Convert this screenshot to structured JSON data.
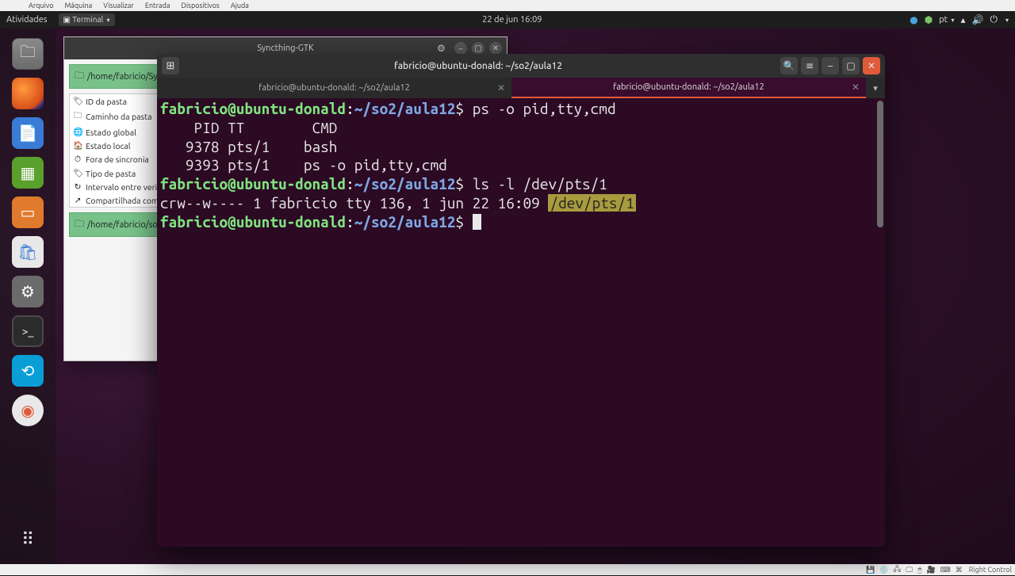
{
  "vbox_menu": {
    "items": [
      "Arquivo",
      "Máquina",
      "Visualizar",
      "Entrada",
      "Dispositivos",
      "Ajuda"
    ]
  },
  "top_panel": {
    "activities": "Atividades",
    "app": "Terminal",
    "clock": "22 de jun  16:09",
    "lang": "pt"
  },
  "syncthing": {
    "title": "Syncthing-GTK",
    "entry1": "/home/fabricio/Sy",
    "rows": [
      {
        "icon": "🏷",
        "label": "ID da pasta"
      },
      {
        "icon": "🗀",
        "label": "Caminho da pasta"
      },
      {
        "icon": "🌐",
        "label": "Estado global"
      },
      {
        "icon": "🏠",
        "label": "Estado local"
      },
      {
        "icon": "⏱",
        "label": "Fora de sincronia"
      },
      {
        "icon": "🏷",
        "label": "Tipo de pasta"
      },
      {
        "icon": "↻",
        "label": "Intervalo entre verifica"
      },
      {
        "icon": "↗",
        "label": "Compartilhada com"
      }
    ],
    "entry2": "/home/fabricio/so"
  },
  "terminal": {
    "window_title": "fabricio@ubuntu-donald: ~/so2/aula12",
    "tab1": "fabricio@ubuntu-donald: ~/so2/aula12",
    "tab2": "fabricio@ubuntu-donald: ~/so2/aula12",
    "prompt_user": "fabricio@ubuntu-donald",
    "prompt_path": "~/so2/aula12",
    "cmd1": "ps -o pid,tty,cmd",
    "out_header": "    PID TT        CMD",
    "out_line1": "   9378 pts/1    bash",
    "out_line2": "   9393 pts/1    ps -o pid,tty,cmd",
    "cmd2": "ls -l /dev/pts/1",
    "out_line3_a": "crw--w---- 1 fabricio tty 136, 1 jun 22 16:09 ",
    "out_line3_hl": "/dev/pts/1"
  },
  "vbox_status": {
    "ctrl": "Right Control"
  }
}
